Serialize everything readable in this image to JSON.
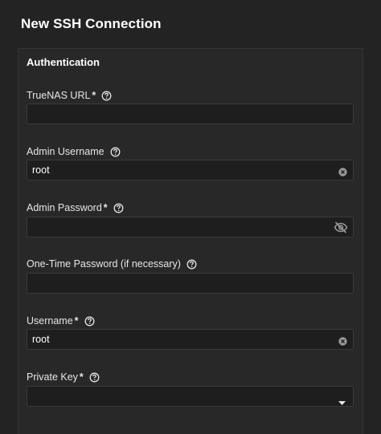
{
  "dialog": {
    "title": "New SSH Connection"
  },
  "section": {
    "title": "Authentication"
  },
  "fields": {
    "truenas_url": {
      "label": "TrueNAS URL",
      "required": "*",
      "value": ""
    },
    "admin_username": {
      "label": "Admin Username",
      "value": "root"
    },
    "admin_password": {
      "label": "Admin Password",
      "required": "*",
      "value": ""
    },
    "otp": {
      "label": "One-Time Password (if necessary)",
      "value": ""
    },
    "username": {
      "label": "Username",
      "required": "*",
      "value": "root"
    },
    "private_key": {
      "label": "Private Key",
      "required": "*",
      "selected": ""
    }
  },
  "icons": {
    "help": "help-circle-icon",
    "clear": "clear-circle-icon",
    "visibility": "eye-off-icon",
    "dropdown": "caret-down-icon"
  },
  "colors": {
    "background": "#232323",
    "panel": "#282828",
    "input": "#1e1e1e",
    "text": "#e6e6e6"
  }
}
